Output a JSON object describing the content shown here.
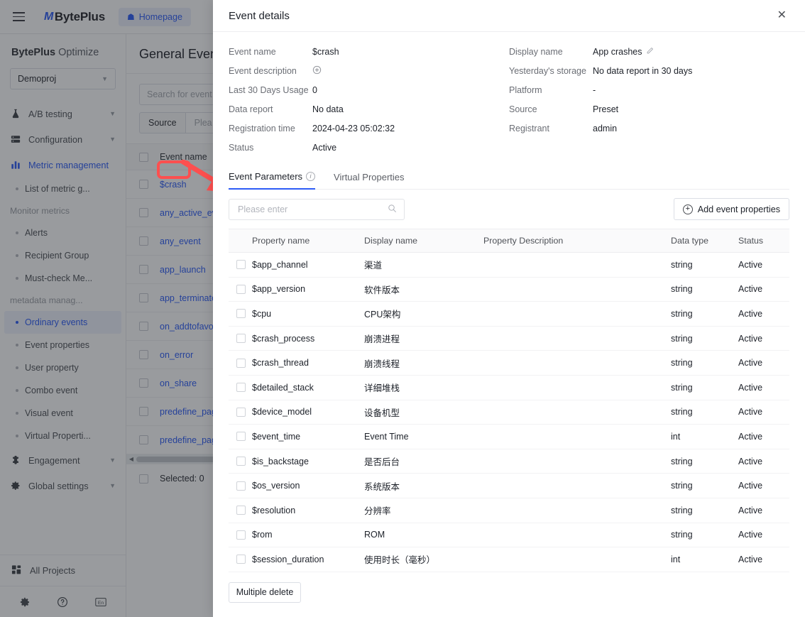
{
  "topbar": {
    "menu_icon": "hamburger-icon",
    "logo_mark": "M",
    "logo_text": "BytePlus",
    "homepage_label": "Homepage",
    "home_icon": "home-icon"
  },
  "sidebar": {
    "brand_bold": "BytePlus",
    "brand_rest": " Optimize",
    "project": "Demoproj",
    "groups": [
      {
        "label": "A/B testing",
        "icon": "flask-icon"
      },
      {
        "label": "Configuration",
        "icon": "server-icon"
      },
      {
        "label": "Metric management",
        "icon": "bar-chart-icon"
      }
    ],
    "metric_children": [
      {
        "label": "List of metric g...",
        "type": "item"
      },
      {
        "label": "Monitor metrics",
        "type": "label"
      },
      {
        "label": "Alerts",
        "type": "item"
      },
      {
        "label": "Recipient Group",
        "type": "item"
      },
      {
        "label": "Must-check Me...",
        "type": "item"
      },
      {
        "label": "metadata manag...",
        "type": "label"
      },
      {
        "label": "Ordinary events",
        "type": "item-selected"
      },
      {
        "label": "Event properties",
        "type": "item"
      },
      {
        "label": "User property",
        "type": "item"
      },
      {
        "label": "Combo event",
        "type": "item"
      },
      {
        "label": "Visual event",
        "type": "item"
      },
      {
        "label": "Virtual Properti...",
        "type": "item"
      }
    ],
    "bottom_groups": [
      {
        "label": "Engagement",
        "icon": "puzzle-icon"
      },
      {
        "label": "Global settings",
        "icon": "gear-icon"
      }
    ],
    "all_projects": "All Projects",
    "footer_icons": [
      "settings-gear-icon",
      "help-question-icon",
      "language-en-icon"
    ],
    "language_badge": "En"
  },
  "main": {
    "page_title": "General Events",
    "search_placeholder": "Search for event n",
    "filter_key": "Source",
    "filter_value_placeholder": "Plea",
    "table_header": "Event name",
    "rows": [
      "$crash",
      "any_active_eve",
      "any_event",
      "app_launch",
      "app_terminate",
      "on_addtofavor",
      "on_error",
      "on_share",
      "predefine_pag",
      "predefine_pag"
    ],
    "selected_label": "Selected: 0"
  },
  "annotation": {
    "color": "#fd4f4f",
    "target": "$crash",
    "shape": "rounded-rect-with-arrow"
  },
  "modal": {
    "title": "Event details",
    "close_icon": "close-icon",
    "details_left": [
      {
        "label": "Event name",
        "value": "$crash"
      },
      {
        "label": "Event description",
        "value": "",
        "icon": "plus-circle-icon"
      },
      {
        "label": "Last 30 Days Usage",
        "value": "0"
      },
      {
        "label": "Data report",
        "value": "No data"
      },
      {
        "label": "Registration time",
        "value": "2024-04-23 05:02:32"
      },
      {
        "label": "Status",
        "value": "Active"
      }
    ],
    "details_right": [
      {
        "label": "Display name",
        "value": "App crashes",
        "icon": "pencil-edit-icon"
      },
      {
        "label": "Yesterday's storage",
        "value": "No data report in 30 days"
      },
      {
        "label": "Platform",
        "value": "-"
      },
      {
        "label": "Source",
        "value": "Preset"
      },
      {
        "label": "Registrant",
        "value": "admin"
      }
    ],
    "tabs": [
      {
        "label": "Event Parameters",
        "active": true,
        "info_icon": "info-circle-icon"
      },
      {
        "label": "Virtual Properties",
        "active": false
      }
    ],
    "search_placeholder": "Please enter",
    "search_value": "",
    "search_icon": "search-icon",
    "add_button_label": "Add event properties",
    "add_button_icon": "plus-circle-icon",
    "table": {
      "columns": [
        "Property name",
        "Display name",
        "Property Description",
        "Data type",
        "Status"
      ],
      "rows": [
        {
          "name": "$app_channel",
          "display": "渠道",
          "desc": "",
          "type": "string",
          "status": "Active"
        },
        {
          "name": "$app_version",
          "display": "软件版本",
          "desc": "",
          "type": "string",
          "status": "Active"
        },
        {
          "name": "$cpu",
          "display": "CPU架构",
          "desc": "",
          "type": "string",
          "status": "Active"
        },
        {
          "name": "$crash_process",
          "display": "崩溃进程",
          "desc": "",
          "type": "string",
          "status": "Active"
        },
        {
          "name": "$crash_thread",
          "display": "崩溃线程",
          "desc": "",
          "type": "string",
          "status": "Active"
        },
        {
          "name": "$detailed_stack",
          "display": "详细堆栈",
          "desc": "",
          "type": "string",
          "status": "Active"
        },
        {
          "name": "$device_model",
          "display": "设备机型",
          "desc": "",
          "type": "string",
          "status": "Active"
        },
        {
          "name": "$event_time",
          "display": "Event Time",
          "desc": "",
          "type": "int",
          "status": "Active"
        },
        {
          "name": "$is_backstage",
          "display": "是否后台",
          "desc": "",
          "type": "string",
          "status": "Active"
        },
        {
          "name": "$os_version",
          "display": "系统版本",
          "desc": "",
          "type": "string",
          "status": "Active"
        },
        {
          "name": "$resolution",
          "display": "分辨率",
          "desc": "",
          "type": "string",
          "status": "Active"
        },
        {
          "name": "$rom",
          "display": "ROM",
          "desc": "",
          "type": "string",
          "status": "Active"
        },
        {
          "name": "$session_duration",
          "display": "使用时长（毫秒）",
          "desc": "",
          "type": "int",
          "status": "Active"
        }
      ]
    },
    "multiple_delete_label": "Multiple delete"
  },
  "colors": {
    "accent": "#2d5cf6",
    "annotation": "#fd4f4f",
    "text": "#1d2129",
    "muted": "#6b6e75"
  }
}
